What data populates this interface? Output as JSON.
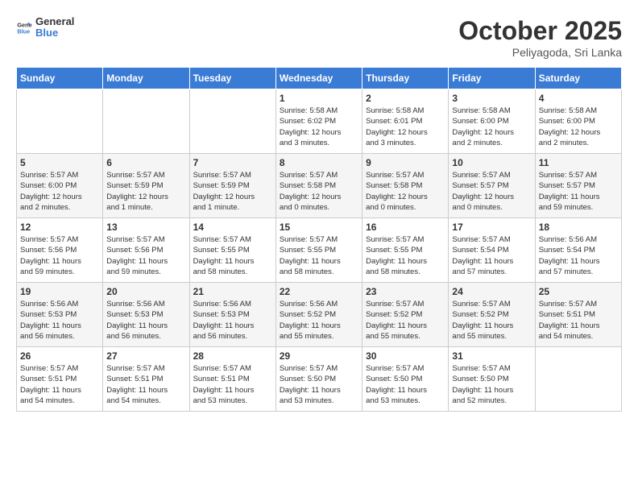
{
  "header": {
    "logo_general": "General",
    "logo_blue": "Blue",
    "month": "October 2025",
    "location": "Peliyagoda, Sri Lanka"
  },
  "weekdays": [
    "Sunday",
    "Monday",
    "Tuesday",
    "Wednesday",
    "Thursday",
    "Friday",
    "Saturday"
  ],
  "weeks": [
    [
      {
        "day": "",
        "info": ""
      },
      {
        "day": "",
        "info": ""
      },
      {
        "day": "",
        "info": ""
      },
      {
        "day": "1",
        "info": "Sunrise: 5:58 AM\nSunset: 6:02 PM\nDaylight: 12 hours\nand 3 minutes."
      },
      {
        "day": "2",
        "info": "Sunrise: 5:58 AM\nSunset: 6:01 PM\nDaylight: 12 hours\nand 3 minutes."
      },
      {
        "day": "3",
        "info": "Sunrise: 5:58 AM\nSunset: 6:00 PM\nDaylight: 12 hours\nand 2 minutes."
      },
      {
        "day": "4",
        "info": "Sunrise: 5:58 AM\nSunset: 6:00 PM\nDaylight: 12 hours\nand 2 minutes."
      }
    ],
    [
      {
        "day": "5",
        "info": "Sunrise: 5:57 AM\nSunset: 6:00 PM\nDaylight: 12 hours\nand 2 minutes."
      },
      {
        "day": "6",
        "info": "Sunrise: 5:57 AM\nSunset: 5:59 PM\nDaylight: 12 hours\nand 1 minute."
      },
      {
        "day": "7",
        "info": "Sunrise: 5:57 AM\nSunset: 5:59 PM\nDaylight: 12 hours\nand 1 minute."
      },
      {
        "day": "8",
        "info": "Sunrise: 5:57 AM\nSunset: 5:58 PM\nDaylight: 12 hours\nand 0 minutes."
      },
      {
        "day": "9",
        "info": "Sunrise: 5:57 AM\nSunset: 5:58 PM\nDaylight: 12 hours\nand 0 minutes."
      },
      {
        "day": "10",
        "info": "Sunrise: 5:57 AM\nSunset: 5:57 PM\nDaylight: 12 hours\nand 0 minutes."
      },
      {
        "day": "11",
        "info": "Sunrise: 5:57 AM\nSunset: 5:57 PM\nDaylight: 11 hours\nand 59 minutes."
      }
    ],
    [
      {
        "day": "12",
        "info": "Sunrise: 5:57 AM\nSunset: 5:56 PM\nDaylight: 11 hours\nand 59 minutes."
      },
      {
        "day": "13",
        "info": "Sunrise: 5:57 AM\nSunset: 5:56 PM\nDaylight: 11 hours\nand 59 minutes."
      },
      {
        "day": "14",
        "info": "Sunrise: 5:57 AM\nSunset: 5:55 PM\nDaylight: 11 hours\nand 58 minutes."
      },
      {
        "day": "15",
        "info": "Sunrise: 5:57 AM\nSunset: 5:55 PM\nDaylight: 11 hours\nand 58 minutes."
      },
      {
        "day": "16",
        "info": "Sunrise: 5:57 AM\nSunset: 5:55 PM\nDaylight: 11 hours\nand 58 minutes."
      },
      {
        "day": "17",
        "info": "Sunrise: 5:57 AM\nSunset: 5:54 PM\nDaylight: 11 hours\nand 57 minutes."
      },
      {
        "day": "18",
        "info": "Sunrise: 5:56 AM\nSunset: 5:54 PM\nDaylight: 11 hours\nand 57 minutes."
      }
    ],
    [
      {
        "day": "19",
        "info": "Sunrise: 5:56 AM\nSunset: 5:53 PM\nDaylight: 11 hours\nand 56 minutes."
      },
      {
        "day": "20",
        "info": "Sunrise: 5:56 AM\nSunset: 5:53 PM\nDaylight: 11 hours\nand 56 minutes."
      },
      {
        "day": "21",
        "info": "Sunrise: 5:56 AM\nSunset: 5:53 PM\nDaylight: 11 hours\nand 56 minutes."
      },
      {
        "day": "22",
        "info": "Sunrise: 5:56 AM\nSunset: 5:52 PM\nDaylight: 11 hours\nand 55 minutes."
      },
      {
        "day": "23",
        "info": "Sunrise: 5:57 AM\nSunset: 5:52 PM\nDaylight: 11 hours\nand 55 minutes."
      },
      {
        "day": "24",
        "info": "Sunrise: 5:57 AM\nSunset: 5:52 PM\nDaylight: 11 hours\nand 55 minutes."
      },
      {
        "day": "25",
        "info": "Sunrise: 5:57 AM\nSunset: 5:51 PM\nDaylight: 11 hours\nand 54 minutes."
      }
    ],
    [
      {
        "day": "26",
        "info": "Sunrise: 5:57 AM\nSunset: 5:51 PM\nDaylight: 11 hours\nand 54 minutes."
      },
      {
        "day": "27",
        "info": "Sunrise: 5:57 AM\nSunset: 5:51 PM\nDaylight: 11 hours\nand 54 minutes."
      },
      {
        "day": "28",
        "info": "Sunrise: 5:57 AM\nSunset: 5:51 PM\nDaylight: 11 hours\nand 53 minutes."
      },
      {
        "day": "29",
        "info": "Sunrise: 5:57 AM\nSunset: 5:50 PM\nDaylight: 11 hours\nand 53 minutes."
      },
      {
        "day": "30",
        "info": "Sunrise: 5:57 AM\nSunset: 5:50 PM\nDaylight: 11 hours\nand 53 minutes."
      },
      {
        "day": "31",
        "info": "Sunrise: 5:57 AM\nSunset: 5:50 PM\nDaylight: 11 hours\nand 52 minutes."
      },
      {
        "day": "",
        "info": ""
      }
    ]
  ]
}
